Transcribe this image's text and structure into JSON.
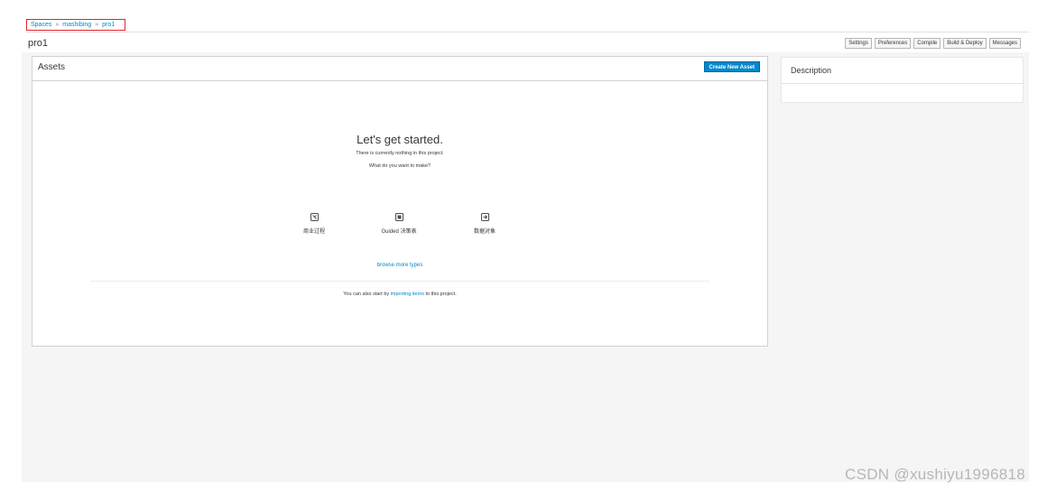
{
  "breadcrumb": {
    "items": [
      "Spaces",
      "mashibing",
      "pro1"
    ],
    "separator": "»"
  },
  "project": {
    "title": "pro1"
  },
  "toolbar": {
    "buttons": [
      "Settings",
      "Preferences",
      "Compile",
      "Build & Deploy",
      "Messages"
    ]
  },
  "assets": {
    "title": "Assets",
    "create_button": "Create New Asset",
    "empty_state": {
      "heading": "Let's get started.",
      "line1": "There is currently nothing in this project.",
      "line2": "What do you want to make?",
      "types": [
        {
          "label": "商业过程",
          "icon": "process-icon"
        },
        {
          "label": "Guided 决策表",
          "icon": "table-icon"
        },
        {
          "label": "数据对象",
          "icon": "data-object-icon"
        }
      ],
      "browse_link": "browse more types",
      "import_prefix": "You can also start by ",
      "import_link": "importing items",
      "import_suffix": " to this project."
    }
  },
  "description": {
    "title": "Description"
  },
  "watermark": "CSDN @xushiyu1996818",
  "colors": {
    "accent": "#0088ce",
    "highlight_border": "#e0262b",
    "panel_bg": "#f5f5f5"
  }
}
